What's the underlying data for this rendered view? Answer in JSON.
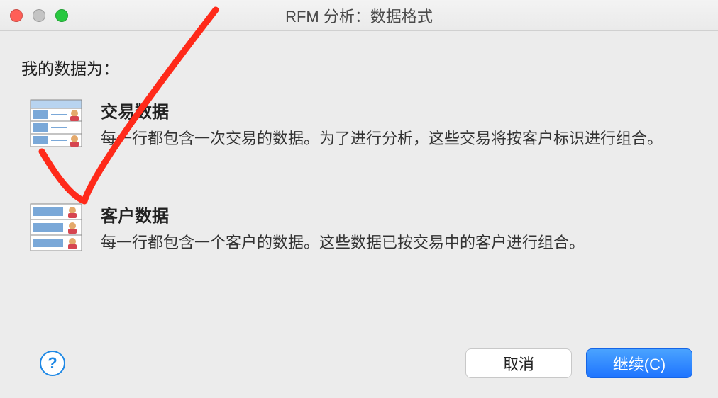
{
  "window": {
    "title": "RFM 分析：数据格式"
  },
  "prompt": "我的数据为：",
  "options": [
    {
      "title": "交易数据",
      "desc": "每一行都包含一次交易的数据。为了进行分析，这些交易将按客户标识进行组合。"
    },
    {
      "title": "客户数据",
      "desc": "每一行都包含一个客户的数据。这些数据已按交易中的客户进行组合。"
    }
  ],
  "buttons": {
    "help": "?",
    "cancel": "取消",
    "continue": "继续(C)"
  },
  "selected_option_index": 0
}
